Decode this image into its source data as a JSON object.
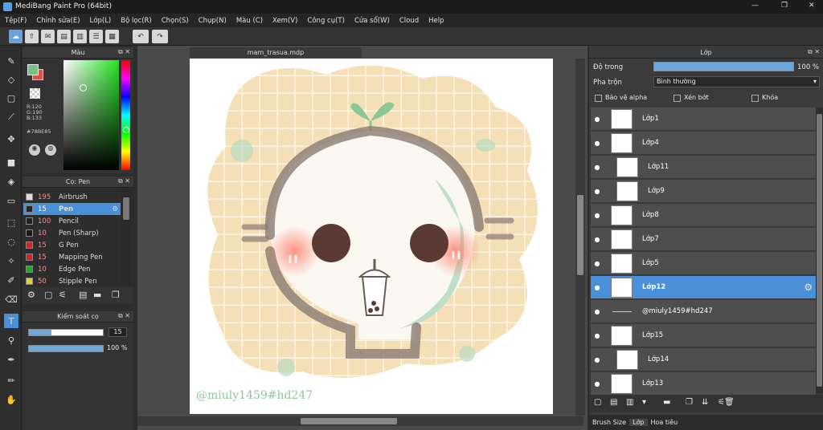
{
  "window": {
    "title": "MediBang Paint Pro (64bit)",
    "controls": [
      "—",
      "❐",
      "✕"
    ]
  },
  "menu": [
    "Tệp(F)",
    "Chỉnh sửa(E)",
    "Lớp(L)",
    "Bộ lọc(R)",
    "Chọn(S)",
    "Chụp(N)",
    "Màu (C)",
    "Xem(V)",
    "Công cụ(T)",
    "Cửa sổ(W)",
    "Cloud",
    "Help"
  ],
  "color_panel": {
    "title": "Màu",
    "r": "R:120",
    "g": "G:190",
    "b": "B:133",
    "hex": "#78BE85",
    "primary_color": "#78BE85",
    "secondary_color": "#e05050"
  },
  "brush_panel": {
    "title": "Cọ: Pen",
    "items": [
      {
        "size": "195",
        "name": "Airbrush",
        "color": "#dddddd"
      },
      {
        "size": "15",
        "name": "Pen",
        "color": "#1e2a33",
        "selected": true
      },
      {
        "size": "100",
        "name": "Pencil",
        "color": "#222222"
      },
      {
        "size": "10",
        "name": "Pen (Sharp)",
        "color": "#1a1a1a"
      },
      {
        "size": "15",
        "name": "G Pen",
        "color": "#e02020"
      },
      {
        "size": "15",
        "name": "Mapping Pen",
        "color": "#e02020"
      },
      {
        "size": "10",
        "name": "Edge Pen",
        "color": "#22aa22"
      },
      {
        "size": "50",
        "name": "Stipple Pen",
        "color": "#e0d020"
      }
    ]
  },
  "brush_control": {
    "title": "Kiểm soát cọ",
    "size": "15",
    "opacity": "100 %",
    "size_fraction": 0.3,
    "opacity_fraction": 1.0
  },
  "canvas": {
    "tab_name": "mam_trasua.mdp",
    "watermark": "@miuly1459#hd247"
  },
  "layer_panel": {
    "title": "Lớp",
    "opacity_label": "Độ trong",
    "opacity_value": "100 %",
    "blend_label": "Pha trộn",
    "blend_value": "Bình thường",
    "protect_alpha": "Bảo vệ alpha",
    "clipping": "Xén bớt",
    "lock": "Khóa",
    "layers": [
      {
        "name": "Lớp1",
        "indent": false,
        "selected": false
      },
      {
        "name": "Lớp4",
        "indent": false,
        "selected": false
      },
      {
        "name": "Lớp11",
        "indent": true,
        "selected": false
      },
      {
        "name": "Lớp9",
        "indent": true,
        "selected": false
      },
      {
        "name": "Lớp8",
        "indent": false,
        "selected": false
      },
      {
        "name": "Lớp7",
        "indent": false,
        "selected": false
      },
      {
        "name": "Lớp5",
        "indent": false,
        "selected": false
      },
      {
        "name": "Lớp12",
        "indent": false,
        "selected": true
      },
      {
        "name": "@miuly1459#hd247",
        "indent": false,
        "selected": false,
        "text_layer": true
      },
      {
        "name": "Lớp15",
        "indent": false,
        "selected": false
      },
      {
        "name": "Lớp14",
        "indent": true,
        "selected": false
      },
      {
        "name": "Lớp13",
        "indent": false,
        "selected": false
      }
    ],
    "bottom_tabs": [
      "Brush Size",
      "Lớp",
      "Hoa tiêu"
    ]
  }
}
